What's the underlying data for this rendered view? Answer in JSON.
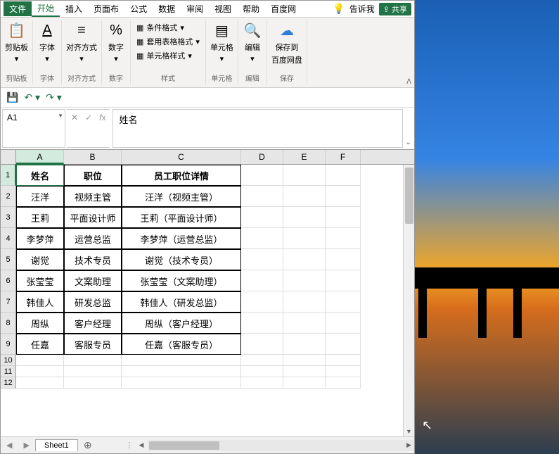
{
  "menu": {
    "file": "文件",
    "tabs": [
      "开始",
      "插入",
      "页面布",
      "公式",
      "数据",
      "审阅",
      "视图",
      "帮助",
      "百度网"
    ],
    "tell_me": "告诉我",
    "share": "共享"
  },
  "ribbon": {
    "clipboard": {
      "label": "剪贴板",
      "btn": "剪贴板"
    },
    "font": {
      "label": "字体",
      "btn": "字体"
    },
    "align": {
      "label": "对齐方式",
      "btn": "对齐方式"
    },
    "number": {
      "label": "数字",
      "btn": "数字"
    },
    "styles": {
      "label": "样式",
      "conditional": "条件格式",
      "table_format": "套用表格格式",
      "cell_styles": "单元格样式"
    },
    "cells": {
      "label": "单元格",
      "btn": "单元格"
    },
    "editing": {
      "label": "编辑",
      "btn": "编辑"
    },
    "save": {
      "label": "保存",
      "btn1": "保存到",
      "btn2": "百度网盘"
    }
  },
  "name_box": "A1",
  "formula_value": "姓名",
  "columns": [
    "A",
    "B",
    "C",
    "D",
    "E",
    "F"
  ],
  "headers": [
    "姓名",
    "职位",
    "员工职位详情"
  ],
  "rows": [
    [
      "汪洋",
      "视频主管",
      "汪洋（视频主管）"
    ],
    [
      "王莉",
      "平面设计师",
      "王莉（平面设计师）"
    ],
    [
      "李梦萍",
      "运营总监",
      "李梦萍（运营总监）"
    ],
    [
      "谢觉",
      "技术专员",
      "谢觉（技术专员）"
    ],
    [
      "张莹莹",
      "文案助理",
      "张莹莹（文案助理）"
    ],
    [
      "韩佳人",
      "研发总监",
      "韩佳人（研发总监）"
    ],
    [
      "周纵",
      "客户经理",
      "周纵（客户经理）"
    ],
    [
      "任嘉",
      "客服专员",
      "任嘉（客服专员）"
    ]
  ],
  "sheet_name": "Sheet1"
}
